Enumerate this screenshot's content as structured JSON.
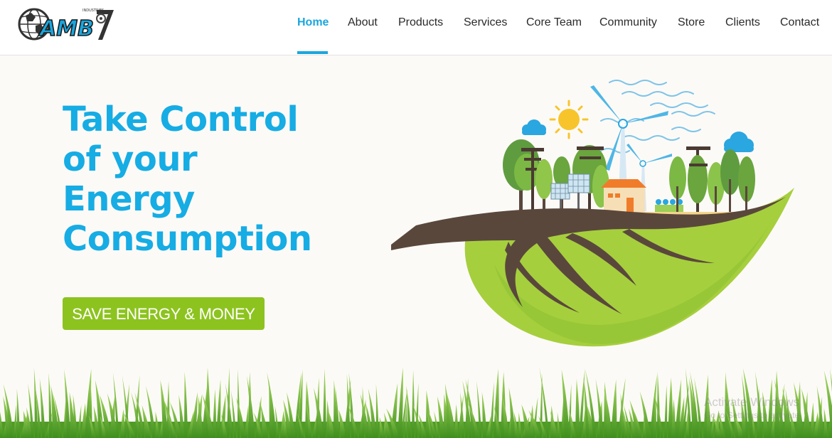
{
  "logo": {
    "text": "AMB",
    "tagline": "INDUSTRIES",
    "brand_color": "#1aa6de"
  },
  "nav": {
    "items": [
      {
        "label": "Home",
        "active": true
      },
      {
        "label": "About",
        "active": false
      },
      {
        "label": "Products",
        "active": false
      },
      {
        "label": "Services",
        "active": false
      },
      {
        "label": "Core Team",
        "active": false
      },
      {
        "label": "Community",
        "active": false
      },
      {
        "label": "Store",
        "active": false
      },
      {
        "label": "Clients",
        "active": false
      },
      {
        "label": "Contact",
        "active": false
      }
    ],
    "active_color": "#1aa6de"
  },
  "hero": {
    "title_lines": [
      "Take Control",
      "of your",
      "Energy",
      "Consumption"
    ],
    "title_color": "#16ace4",
    "cta_label": "SAVE ENERGY & MONEY",
    "cta_color": "#8dc31f"
  },
  "illustration": {
    "name": "eco-leaf-island",
    "elements": [
      "sun-icon",
      "wind-turbine-icon",
      "cloud-icon",
      "tree-icon",
      "solar-panel-icon",
      "house-icon",
      "leaf-icon"
    ]
  },
  "watermark": {
    "line1": "Activate Windows",
    "line2": "Go to Settings to activate"
  }
}
